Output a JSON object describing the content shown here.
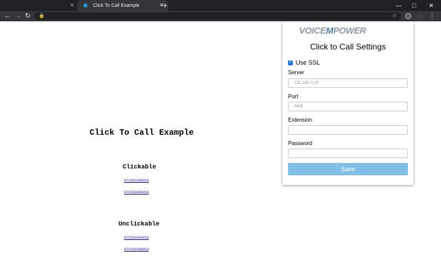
{
  "browser": {
    "tabs": [
      {
        "title": "",
        "active": false
      },
      {
        "title": "Click To Call Example",
        "active": true
      }
    ],
    "new_tab_icon": "plus-icon",
    "window_controls": [
      "minimize-icon",
      "maximize-icon",
      "close-icon"
    ],
    "nav_icons": [
      "back-icon",
      "forward-icon",
      "reload-icon"
    ],
    "address": ""
  },
  "page": {
    "title": "Click To Call Example",
    "clickable": {
      "heading": "Clickable",
      "numbers": [
        "971501000910",
        "971501000910"
      ]
    },
    "unclickable": {
      "heading": "Unclickable",
      "numbers": [
        "971501000910",
        "971501000910"
      ]
    }
  },
  "popup": {
    "logo_text": {
      "part1": "VOICE",
      "part2": "M",
      "part3": "POWER"
    },
    "title": "Click to Call Settings",
    "use_ssl": {
      "label": "Use SSL",
      "checked": true
    },
    "server": {
      "label": "Server",
      "placeholder": "192.168.0.10"
    },
    "port": {
      "label": "Port",
      "placeholder": "4445"
    },
    "extension": {
      "label": "Extension",
      "value": ""
    },
    "password": {
      "label": "Password",
      "value": ""
    },
    "save_label": "Save"
  },
  "colors": {
    "chrome_dark": "#202124",
    "chrome_toolbar": "#35363a",
    "save_button": "#7fbfe8",
    "link": "#1a0dab"
  }
}
